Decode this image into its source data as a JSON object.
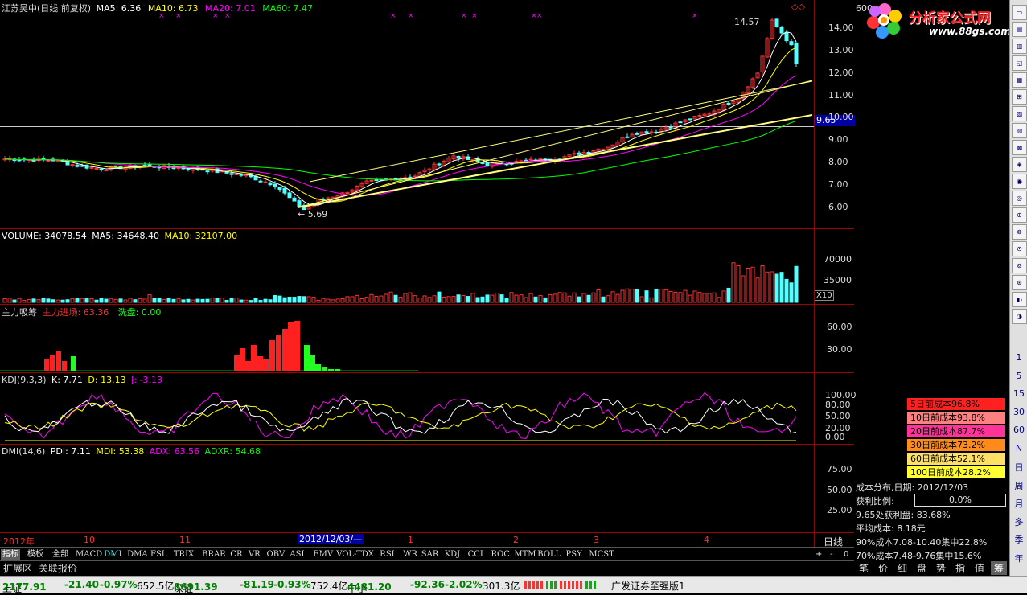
{
  "main": {
    "title": "江苏吴中(日线 前复权)",
    "ma5": "MA5: 6.36",
    "ma10": "MA10: 6.73",
    "ma20": "MA20: 7.01",
    "ma60": "MA60: 7.47",
    "high_label": "14.57",
    "low_label": "5.69",
    "price_ticks": [
      "14.00",
      "13.00",
      "12.00",
      "11.00",
      "10.00",
      "9.00",
      "8.00",
      "7.00",
      "6.00"
    ],
    "crosshair_price": "9.65",
    "profile_label": "600"
  },
  "volume": {
    "label": "VOLUME: 34078.54",
    "ma5": "MA5: 34648.40",
    "ma10": "MA10: 32107.00",
    "ticks": [
      "70000",
      "35000"
    ],
    "unit": "X10"
  },
  "zljc": {
    "name": "主力吸筹",
    "in": "主力进场: 63.36",
    "wash": "洗盘: 0.00",
    "ticks": [
      "60.00",
      "30.00"
    ]
  },
  "kdj": {
    "label": "KDJ(9,3,3)",
    "k": "K: 7.71",
    "d": "D: 13.13",
    "j": "J: -3.13",
    "ticks": [
      "100.00",
      "80.00",
      "50.00",
      "20.00",
      "0.00"
    ]
  },
  "dmi": {
    "label": "DMI(14,6)",
    "pdi": "PDI: 7.11",
    "mdi": "MDI: 53.38",
    "adx": "ADX: 63.56",
    "adxr": "ADXR: 54.68",
    "ticks": [
      "75.00",
      "50.00",
      "25.00"
    ]
  },
  "date_axis": {
    "labels": [
      "2012年",
      "10",
      "11",
      "1",
      "2",
      "3",
      "4"
    ],
    "cursor_date": "2012/12/03/—",
    "period": "日线"
  },
  "cost_rows": [
    {
      "label": "5日前成本96.8%",
      "color": "#ff2020"
    },
    {
      "label": "10日前成本93.8%",
      "color": "#ff8080"
    },
    {
      "label": "20日前成本87.7%",
      "color": "#ff3399"
    },
    {
      "label": "30日前成本73.2%",
      "color": "#ff8c1a"
    },
    {
      "label": "60日前成本52.1%",
      "color": "#ffe066"
    },
    {
      "label": "100日前成本28.2%",
      "color": "#ffff33"
    }
  ],
  "cost_info": {
    "title": "成本分布,日期: 2012/12/03",
    "profit_label": "获利比例:",
    "profit_value": "0.0%",
    "at_price": "9.65处获利盘: 83.68%",
    "avg_cost": "平均成本: 8.18元",
    "range90": "90%成本7.08-10.40集中22.8%",
    "range70": "70%成本7.48-9.76集中15.6%"
  },
  "right_tabs": [
    "笔",
    "价",
    "细",
    "盘",
    "势",
    "指",
    "值",
    "筹"
  ],
  "tabs": [
    "指标",
    "模板",
    "全部"
  ],
  "indicators": [
    "MACD",
    "DMI",
    "DMA",
    "FSL",
    "TRIX",
    "BRAR",
    "CR",
    "VR",
    "OBV",
    "ASI",
    "EMV",
    "VOL-TDX",
    "RSI",
    "WR",
    "SAR",
    "KDJ",
    "CCI",
    "ROC",
    "MTM",
    "BOLL",
    "PSY",
    "MCST"
  ],
  "zoom": [
    "+",
    "-",
    "0"
  ],
  "subtabs": [
    "扩展区",
    "关联报价"
  ],
  "status": {
    "sh_name": "上证",
    "sh_val": "2177.91",
    "sh_chg": "-21.40",
    "sh_pct": "-0.97%",
    "sh_amt": "652.5亿",
    "sz_name": "深证",
    "sz_val": "8691.39",
    "sz_chg": "-81.19",
    "sz_pct": "-0.93%",
    "sz_amt": "752.4亿",
    "zx_name": "中小",
    "zx_val": "4481.20",
    "zx_chg": "-92.36",
    "zx_pct": "-2.02%",
    "zx_amt": "301.3亿",
    "broker": "广发证券至强版1"
  },
  "toolbar_numbers": [
    "1",
    "5",
    "15",
    "30",
    "60",
    "N",
    "日",
    "周",
    "月",
    "多",
    "季",
    "年"
  ],
  "logo": {
    "text": "分析家公式网",
    "url": "www.88gs.com"
  },
  "colors": {
    "up": "#ff3232",
    "down": "#54ffff",
    "ma5": "#ffffff",
    "ma10": "#ffff00",
    "ma20": "#ff00ff",
    "ma60": "#00ff00"
  }
}
